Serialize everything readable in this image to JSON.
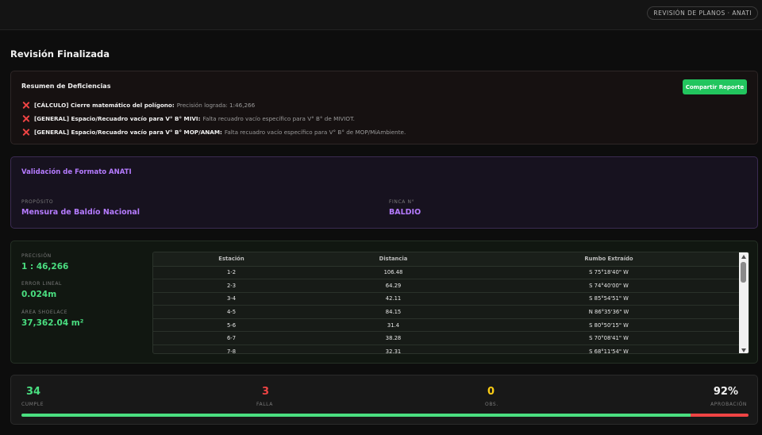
{
  "header": {
    "badge": "Revisión de Planos · ANATI"
  },
  "page": {
    "title": "Revisión Finalizada"
  },
  "deficiencies": {
    "title": "Resumen de Deficiencias",
    "share_label": "Compartir Reporte",
    "items": [
      {
        "label": "[CÁLCULO] Cierre matemático del polígono:",
        "desc": "Precisión lograda: 1:46,266"
      },
      {
        "label": "[GENERAL] Espacio/Recuadro vacío para V° B° MIVI:",
        "desc": "Falta recuadro vacío específico para V° B° de MIVIOT."
      },
      {
        "label": "[GENERAL] Espacio/Recuadro vacío para V° B° MOP/ANAM:",
        "desc": "Falta recuadro vacío específico para V° B° de MOP/MiAmbiente."
      }
    ]
  },
  "format": {
    "title": "Validación de Formato ANATI",
    "proposito_label": "Propósito",
    "proposito_value": "Mensura de Baldío Nacional",
    "finca_label": "Finca N°",
    "finca_value": "BALDIO"
  },
  "stats": {
    "precision_label": "Precisión",
    "precision_value": "1 : 46,266",
    "error_label": "Error Lineal",
    "error_value": "0.024m",
    "area_label": "Área Shoelace",
    "area_value": "37,362.04 m²"
  },
  "table": {
    "headers": [
      "Estación",
      "Distancia",
      "Rumbo Extraído"
    ],
    "rows": [
      [
        "1-2",
        "106.48",
        "S 75°18'40\" W"
      ],
      [
        "2-3",
        "64.29",
        "S 74°40'00\" W"
      ],
      [
        "3-4",
        "42.11",
        "S 85°54'51\" W"
      ],
      [
        "4-5",
        "84.15",
        "N 86°35'36\" W"
      ],
      [
        "5-6",
        "31.4",
        "S 80°50'15\" W"
      ],
      [
        "6-7",
        "38.28",
        "S 70°08'41\" W"
      ],
      [
        "7-8",
        "32.31",
        "S 68°11'54\" W"
      ]
    ]
  },
  "summary": {
    "cumple_value": "34",
    "cumple_label": "Cumple",
    "falla_value": "3",
    "falla_label": "Falla",
    "obs_value": "0",
    "obs_label": "Obs.",
    "approval_value": "92%",
    "approval_label": "Aprobación",
    "approval_fraction": 0.92
  },
  "colors": {
    "ok": "#4ade80",
    "fail": "#ef4444",
    "warn": "#facc15",
    "accent": "#b57bff",
    "button": "#22c55e"
  }
}
